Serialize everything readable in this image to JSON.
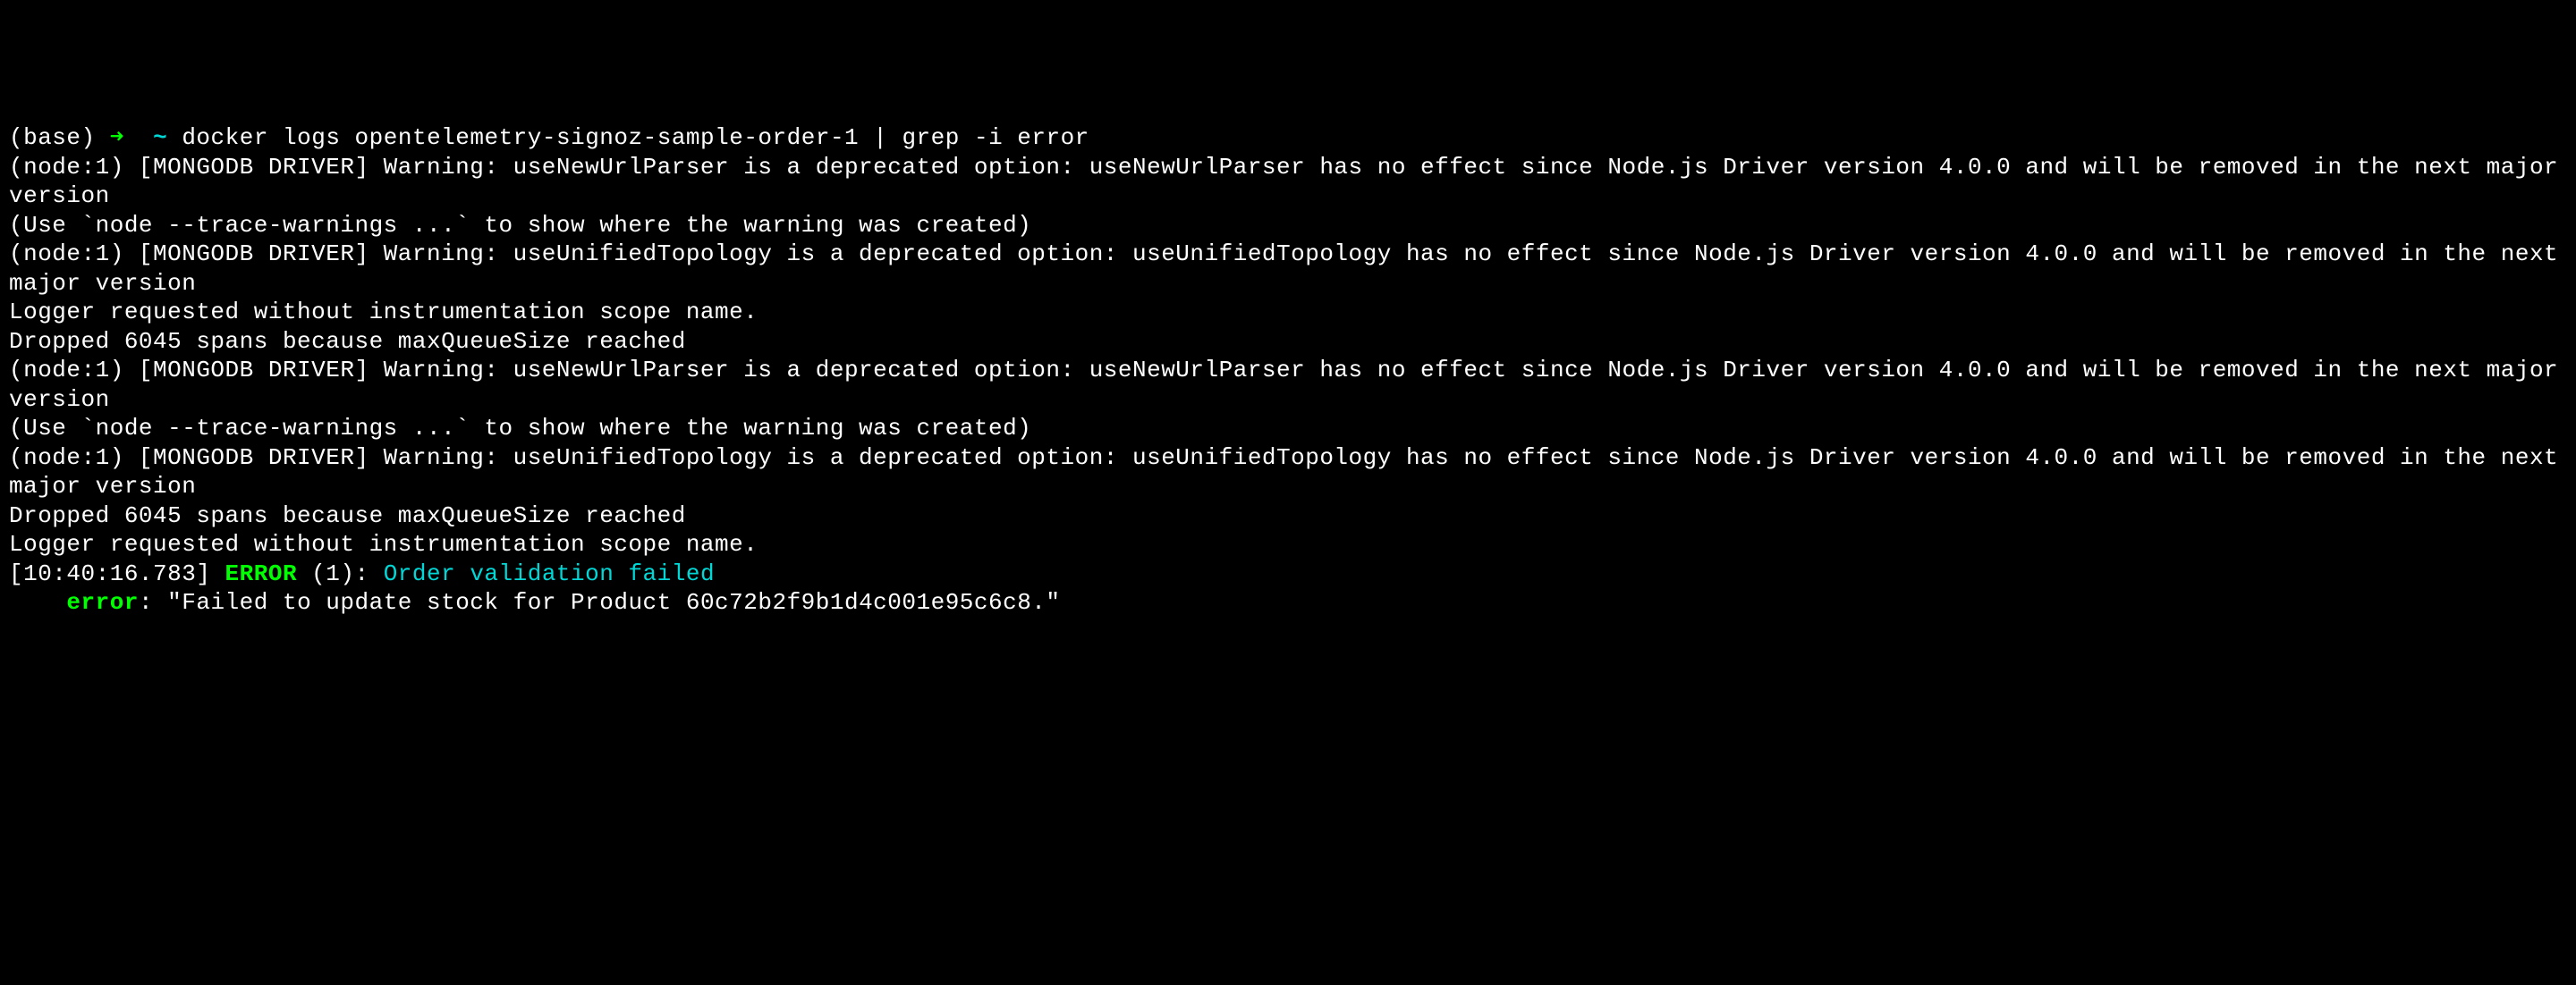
{
  "prompt": {
    "env": "(base)",
    "arrow": "➜",
    "tilde": "~",
    "command": "docker logs opentelemetry-signoz-sample-order-1 | grep -i error"
  },
  "lines": {
    "l1": "(node:1) [MONGODB DRIVER] Warning: useNewUrlParser is a deprecated option: useNewUrlParser has no effect since Node.js Driver version 4.0.0 and will be removed in the next major version",
    "l2": "(Use `node --trace-warnings ...` to show where the warning was created)",
    "l3": "(node:1) [MONGODB DRIVER] Warning: useUnifiedTopology is a deprecated option: useUnifiedTopology has no effect since Node.js Driver version 4.0.0 and will be removed in the next major version",
    "l4": "Logger requested without instrumentation scope name.",
    "l5": "Dropped 6045 spans because maxQueueSize reached",
    "l6": "(node:1) [MONGODB DRIVER] Warning: useNewUrlParser is a deprecated option: useNewUrlParser has no effect since Node.js Driver version 4.0.0 and will be removed in the next major version",
    "l7": "(Use `node --trace-warnings ...` to show where the warning was created)",
    "l8": "(node:1) [MONGODB DRIVER] Warning: useUnifiedTopology is a deprecated option: useUnifiedTopology has no effect since Node.js Driver version 4.0.0 and will be removed in the next major version",
    "l9": "Dropped 6045 spans because maxQueueSize reached",
    "l10": "Logger requested without instrumentation scope name."
  },
  "error_line": {
    "timestamp": "[10:40:16.783]",
    "level": "ERROR",
    "pid": "(1):",
    "message": "Order validation failed"
  },
  "error_detail": {
    "indent": "    ",
    "key": "error",
    "colon": ": ",
    "value": "\"Failed to update stock for Product 60c72b2f9b1d4c001e95c6c8.\""
  }
}
